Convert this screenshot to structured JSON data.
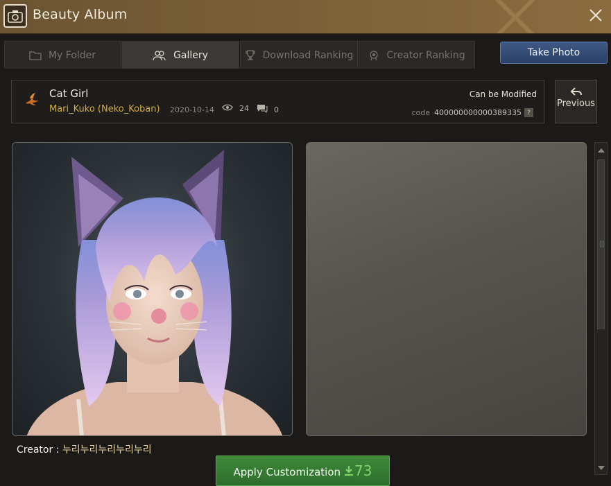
{
  "window": {
    "title": "Beauty Album",
    "accent": "#7d6238"
  },
  "tabs": [
    {
      "label": "My Folder",
      "icon": "folder-icon",
      "active": false
    },
    {
      "label": "Gallery",
      "icon": "users-icon",
      "active": true
    },
    {
      "label": "Download Ranking",
      "icon": "trophy-icon",
      "active": false
    },
    {
      "label": "Creator Ranking",
      "icon": "medal-icon",
      "active": false
    }
  ],
  "toolbar": {
    "take_photo_label": "Take Photo"
  },
  "entry": {
    "name": "Cat Girl",
    "author": "Mari_Kuko (Neko_Koban)",
    "date": "2020-10-14",
    "views": "24",
    "comments": "0",
    "modifiable_label": "Can be Modified",
    "code_label": "code",
    "code": "400000000000389335",
    "help_glyph": "?"
  },
  "nav": {
    "previous_label": "Previous"
  },
  "creator": {
    "label": "Creator : ",
    "value": "누리누리누리누리누리"
  },
  "apply": {
    "label": "Apply Customization",
    "downloads": "73",
    "color": "#2d6d2b"
  }
}
